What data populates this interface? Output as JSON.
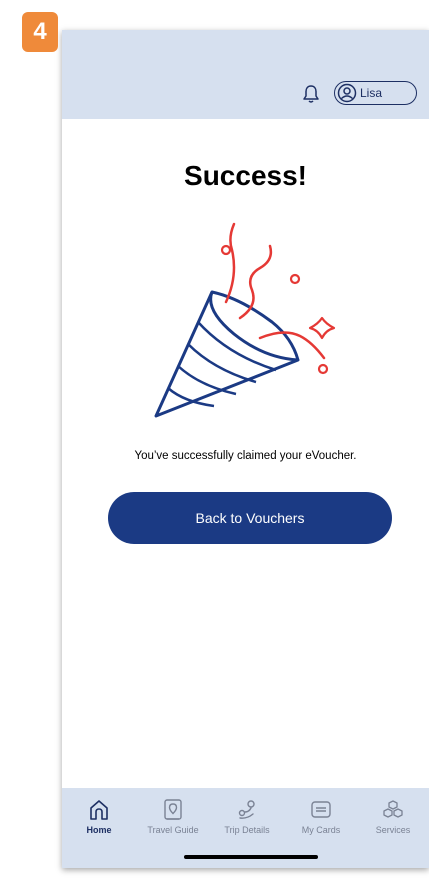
{
  "step_badge": "4",
  "header": {
    "user_name": "Lisa",
    "icons": [
      "bell-icon",
      "user-avatar-icon"
    ]
  },
  "main": {
    "title": "Success!",
    "illustration": "party-popper-icon",
    "message": "You’ve successfully claimed your eVoucher.",
    "cta_label": "Back to Vouchers"
  },
  "tabbar": {
    "items": [
      {
        "label": "Home",
        "icon": "home-icon",
        "active": true
      },
      {
        "label": "Travel Guide",
        "icon": "map-pin-icon",
        "active": false
      },
      {
        "label": "Trip Details",
        "icon": "route-icon",
        "active": false
      },
      {
        "label": "My Cards",
        "icon": "card-icon",
        "active": false
      },
      {
        "label": "Services",
        "icon": "boxes-icon",
        "active": false
      }
    ]
  },
  "colors": {
    "brand_navy": "#1b3a84",
    "header_bg": "#d6e0ef",
    "confetti_red": "#e53935",
    "badge_orange": "#ef8a3a"
  }
}
